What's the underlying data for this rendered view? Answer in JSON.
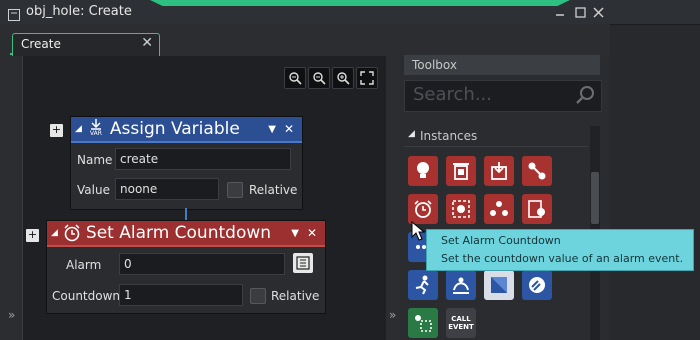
{
  "window": {
    "title": "obj_hole: Create"
  },
  "tab": {
    "label": "Create",
    "close": "✕"
  },
  "blocks": {
    "assign": {
      "title": "Assign Variable",
      "icon_caption": "VAR",
      "name_label": "Name",
      "name_value": "create",
      "value_label": "Value",
      "value_value": "noone",
      "relative_label": "Relative"
    },
    "alarm": {
      "title": "Set Alarm Countdown",
      "alarm_label": "Alarm",
      "alarm_value": "0",
      "countdown_label": "Countdown",
      "countdown_value": "1",
      "relative_label": "Relative"
    }
  },
  "toolbox": {
    "header": "Toolbox",
    "search_placeholder": "Search...",
    "section": "Instances",
    "call_event_label": "CALL\nEVENT"
  },
  "tooltip": {
    "title": "Set Alarm Countdown",
    "description": "Set the countdown value of an alarm event."
  },
  "colors": {
    "accent": "#2fd08a",
    "assign_header": "#2c4f94",
    "alarm_header": "#9c2f2f",
    "tooltip": "#6dd4dd"
  }
}
